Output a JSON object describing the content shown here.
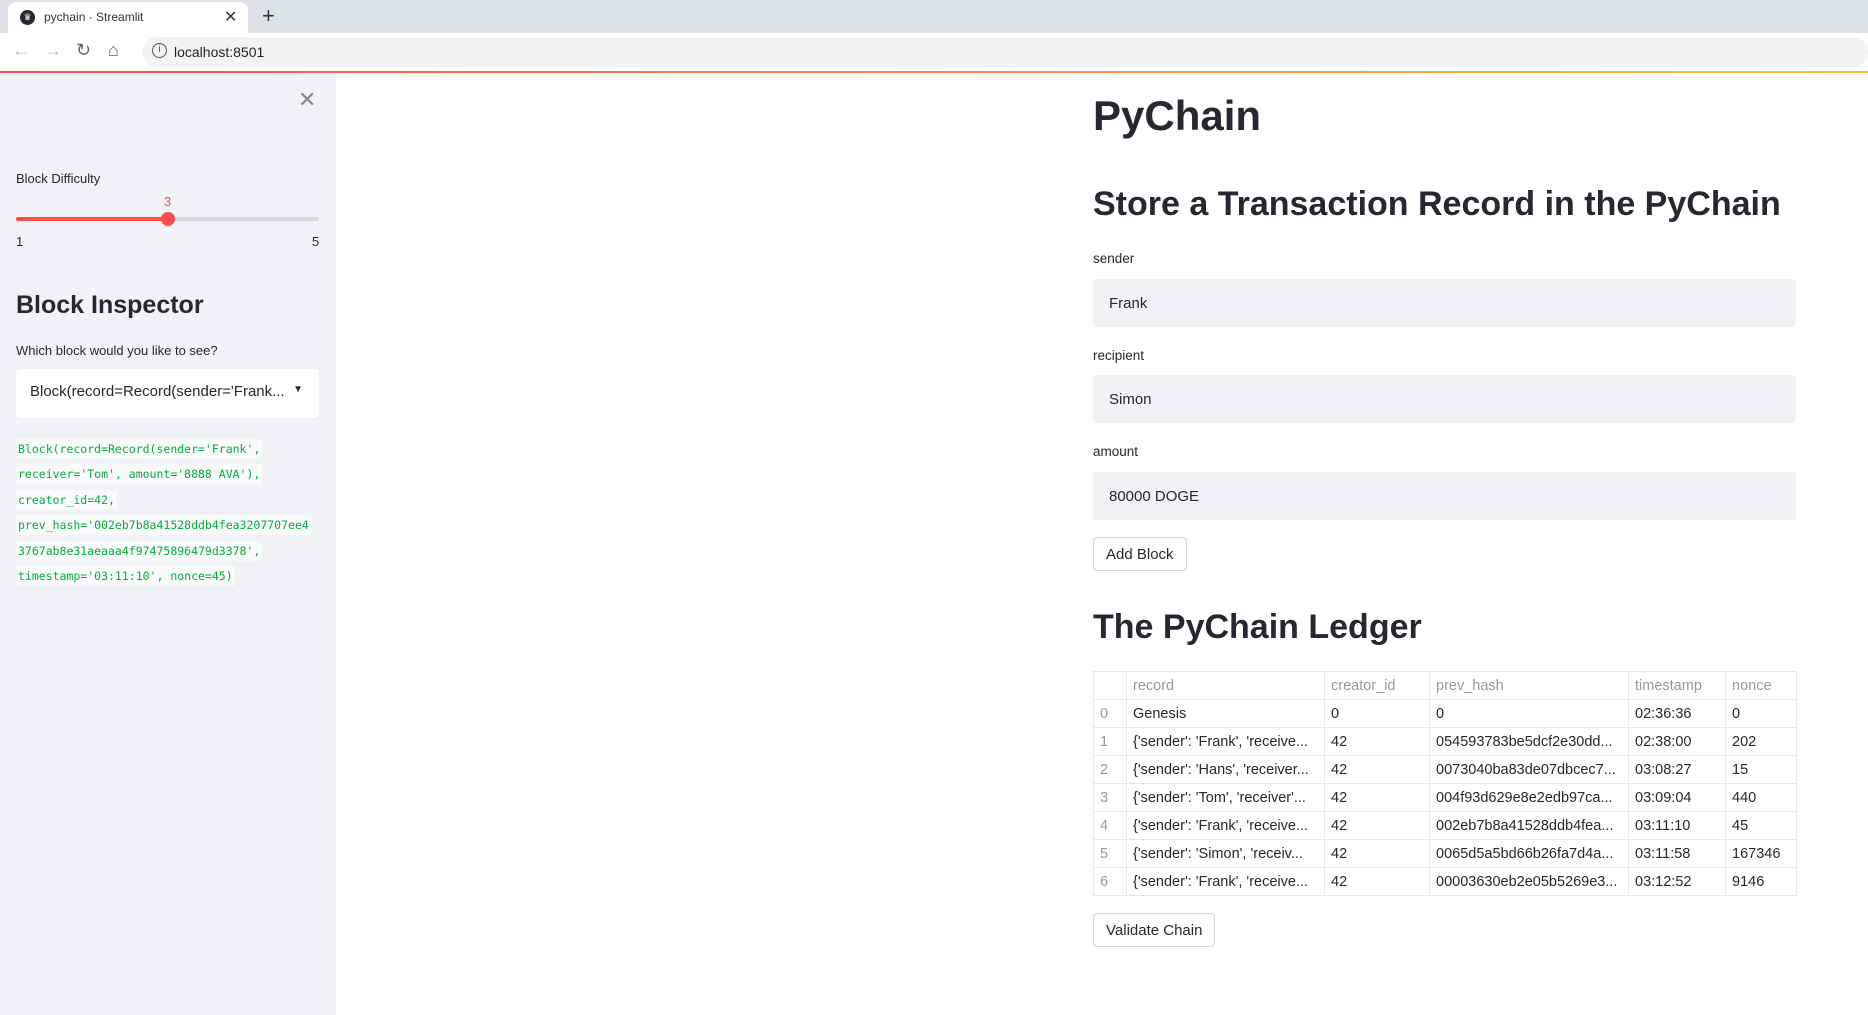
{
  "browser": {
    "tab_title": "pychain · Streamlit",
    "url": "localhost:8501"
  },
  "sidebar": {
    "slider": {
      "label": "Block Difficulty",
      "value": 3,
      "min": 1,
      "max": 5,
      "min_label": "1",
      "max_label": "5",
      "value_label": "3"
    },
    "inspector_title": "Block Inspector",
    "select_label": "Which block would you like to see?",
    "select_value": "Block(record=Record(sender='Frank...",
    "code_lines": [
      "Block(record=Record(sender='Frank',",
      "receiver='Tom', amount='8888 AVA'),",
      "creator_id=42,",
      "prev_hash='002eb7b8a41528ddb4fea3207707ee4",
      "3767ab8e31aeaaa4f97475896479d3378',",
      "timestamp='03:11:10', nonce=45)"
    ]
  },
  "main": {
    "title": "PyChain",
    "form_title": "Store a Transaction Record in the PyChain",
    "sender": {
      "label": "sender",
      "value": "Frank"
    },
    "recipient": {
      "label": "recipient",
      "value": "Simon"
    },
    "amount": {
      "label": "amount",
      "value": "80000 DOGE"
    },
    "add_button": "Add Block",
    "ledger_title": "The PyChain Ledger",
    "table": {
      "columns": [
        "",
        "record",
        "creator_id",
        "prev_hash",
        "timestamp",
        "nonce"
      ],
      "rows": [
        [
          "0",
          "Genesis",
          "0",
          "0",
          "02:36:36",
          "0"
        ],
        [
          "1",
          "{'sender': 'Frank', 'receive...",
          "42",
          "054593783be5dcf2e30dd...",
          "02:38:00",
          "202"
        ],
        [
          "2",
          "{'sender': 'Hans', 'receiver...",
          "42",
          "0073040ba83de07dbcec7...",
          "03:08:27",
          "15"
        ],
        [
          "3",
          "{'sender': 'Tom', 'receiver'...",
          "42",
          "004f93d629e8e2edb97ca...",
          "03:09:04",
          "440"
        ],
        [
          "4",
          "{'sender': 'Frank', 'receive...",
          "42",
          "002eb7b8a41528ddb4fea...",
          "03:11:10",
          "45"
        ],
        [
          "5",
          "{'sender': 'Simon', 'receiv...",
          "42",
          "0065d5a5bd66b26fa7d4a...",
          "03:11:58",
          "167346"
        ],
        [
          "6",
          "{'sender': 'Frank', 'receive...",
          "42",
          "00003630eb2e05b5269e3...",
          "03:12:52",
          "9146"
        ]
      ]
    },
    "validate_button": "Validate Chain"
  },
  "colors": {
    "accent": "#ff4b4b",
    "code": "#09ab3b",
    "sidebar_bg": "#f0f2f6"
  }
}
